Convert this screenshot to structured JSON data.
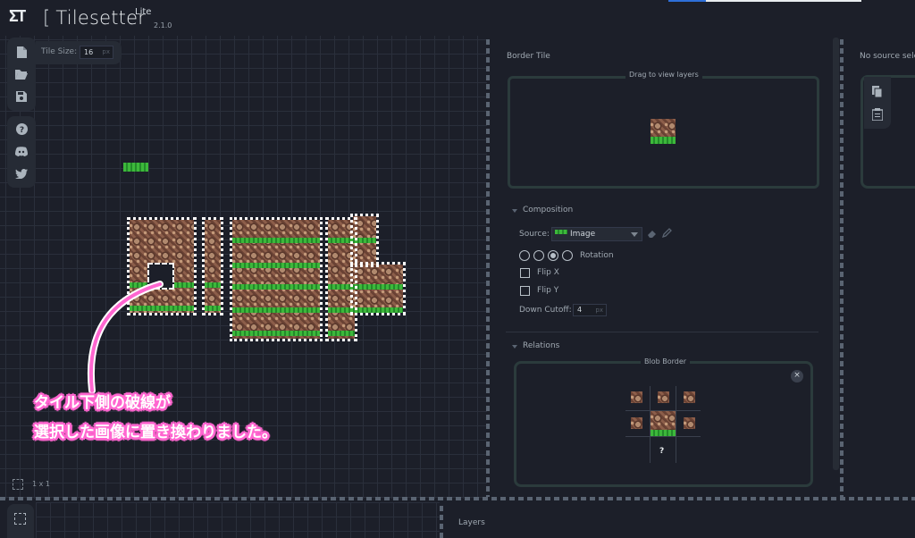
{
  "app": {
    "logo": "ƩT",
    "bracket": "[",
    "title": "Tilesetter",
    "edition": "Lite",
    "version": "2.1.0"
  },
  "canvas": {
    "tile_size_label": "Tile Size:",
    "tile_size_value": "16",
    "tile_size_unit": "px",
    "cursor_size": "1 x 1"
  },
  "icons": {
    "new": "file-icon",
    "open": "folder-open-icon",
    "save": "save-icon",
    "help": "help-icon",
    "discord": "discord-icon",
    "twitter": "twitter-icon",
    "copy": "copy-icon",
    "paste": "clipboard-icon",
    "select": "selection-icon"
  },
  "border_tile": {
    "title": "Border Tile",
    "drag_hint": "Drag to view layers"
  },
  "composition": {
    "title": "Composition",
    "source_label": "Source:",
    "source_value": "Image",
    "rotation_label": "Rotation",
    "rotation_selected_index": 2,
    "flip_x_label": "Flip X",
    "flip_y_label": "Flip Y",
    "down_cutoff_label": "Down Cutoff:",
    "down_cutoff_value": "4",
    "down_cutoff_unit": "px"
  },
  "relations": {
    "title": "Relations",
    "blob_border_label": "Blob Border",
    "close_symbol": "×",
    "unknown_symbol": "?"
  },
  "source_panel": {
    "no_source_text": "No source sele"
  },
  "layers": {
    "title": "Layers"
  },
  "annotation": {
    "line1": "タイル下側の破線が",
    "line2": "選択した画像に置き換わりました。",
    "color": "#ff66d0"
  },
  "colors": {
    "background": "#1c1f29",
    "panel": "#262b35",
    "panel_border": "#2b3b3c",
    "grass": "#3db83b",
    "dirt": "#7a5040",
    "accent_blue": "#2e6fd9"
  }
}
